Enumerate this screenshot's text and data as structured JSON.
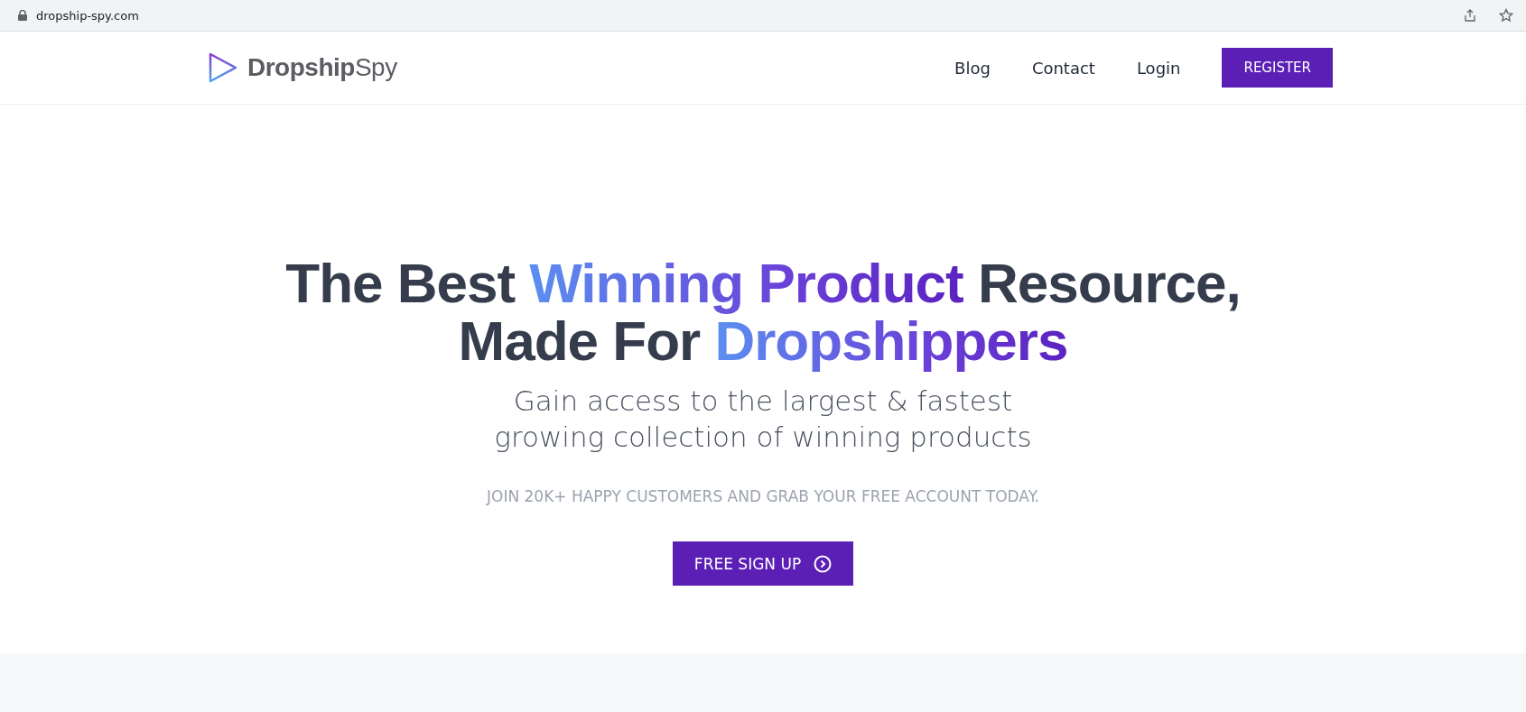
{
  "browser": {
    "url": "dropship-spy.com"
  },
  "header": {
    "logo": "**Dropship**Spy",
    "nav": [
      {
        "label": "Blog",
        "kind": "link"
      },
      {
        "label": "Contact",
        "kind": "link"
      },
      {
        "label": "Login",
        "kind": "link"
      },
      {
        "label": "REGISTER",
        "kind": "button"
      }
    ]
  },
  "hero": {
    "headline": [
      [
        {
          "text": "The Best ",
          "highlight": false
        },
        {
          "text": "Winning Product",
          "highlight": true
        },
        {
          "text": " Resource,",
          "highlight": false
        }
      ],
      [
        {
          "text": "Made For ",
          "highlight": false
        },
        {
          "text": "Dropshippers",
          "highlight": true
        }
      ]
    ],
    "subtitle": [
      "Gain access to the largest & fastest",
      "growing collection of winning products"
    ],
    "tagline": "JOIN 20K+ HAPPY CUSTOMERS AND GRAB YOUR FREE ACCOUNT TODAY.",
    "cta": "FREE SIGN UP"
  }
}
